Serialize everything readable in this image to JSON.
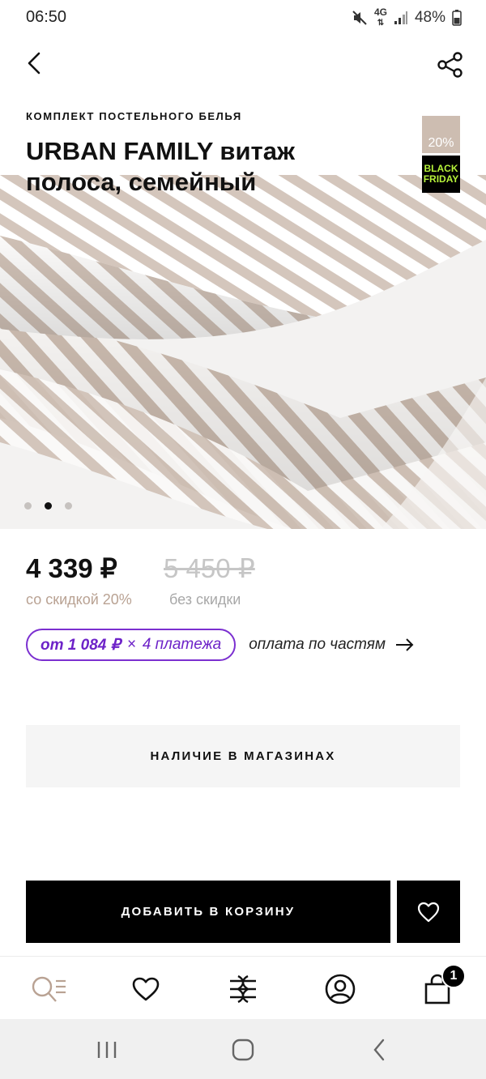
{
  "status_bar": {
    "time": "06:50",
    "network": "4G",
    "battery": "48%",
    "icons": [
      "mute-icon",
      "network-4g-icon",
      "signal-icon",
      "battery-icon"
    ]
  },
  "nav": {
    "back_icon": "back-arrow-icon",
    "share_icon": "share-icon"
  },
  "product": {
    "category": "КОМПЛЕКТ ПОСТЕЛЬНОГО БЕЛЬЯ",
    "title": "URBAN FAMILY витаж полоса, семейный",
    "badge_discount": "20%",
    "badge_bf_line1": "BLACK",
    "badge_bf_line2": "FRIDAY",
    "gallery": {
      "count": 3,
      "active_index": 1
    }
  },
  "price": {
    "current": "4 339 ₽",
    "old": "5 450 ₽",
    "current_note": "со скидкой 20%",
    "old_note": "без скидки"
  },
  "installments": {
    "from": "от 1 084 ₽",
    "times": "×",
    "count": "4 платежа",
    "link": "оплата по частям"
  },
  "actions": {
    "stock": "НАЛИЧИЕ В МАГАЗИНАХ",
    "add_to_cart": "ДОБАВИТЬ В КОРЗИНУ"
  },
  "tab_bar": {
    "items": [
      "catalog-search-icon",
      "favorites-icon",
      "brand-logo-icon",
      "profile-icon",
      "cart-icon"
    ],
    "cart_count": "1"
  },
  "colors": {
    "accent": "#b9a293",
    "installment": "#6d22c8",
    "badge_bf_text": "#b6f23a",
    "stripe": "#d4c6bc"
  }
}
